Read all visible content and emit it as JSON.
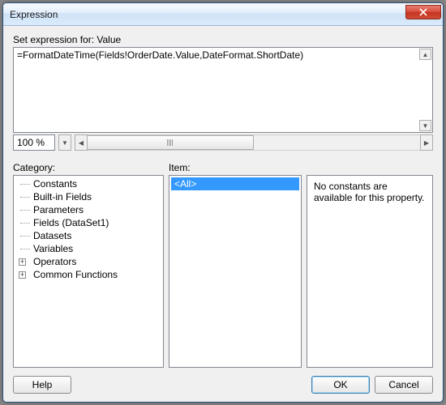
{
  "window": {
    "title": "Expression"
  },
  "editor": {
    "label": "Set expression for: Value",
    "value": "=FormatDateTime(Fields!OrderDate.Value,DateFormat.ShortDate)",
    "zoom": "100 %"
  },
  "panels": {
    "category_label": "Category:",
    "item_label": "Item:",
    "categories": [
      {
        "label": "Constants",
        "expandable": false
      },
      {
        "label": "Built-in Fields",
        "expandable": false
      },
      {
        "label": "Parameters",
        "expandable": false
      },
      {
        "label": "Fields (DataSet1)",
        "expandable": false
      },
      {
        "label": "Datasets",
        "expandable": false
      },
      {
        "label": "Variables",
        "expandable": false
      },
      {
        "label": "Operators",
        "expandable": true
      },
      {
        "label": "Common Functions",
        "expandable": true
      }
    ],
    "items": [
      {
        "label": "<All>",
        "selected": true
      }
    ],
    "description": "No constants are available for this property."
  },
  "buttons": {
    "help": "Help",
    "ok": "OK",
    "cancel": "Cancel"
  },
  "glyphs": {
    "up": "▲",
    "down": "▼",
    "left": "◀",
    "right": "▶",
    "plus": "+"
  }
}
